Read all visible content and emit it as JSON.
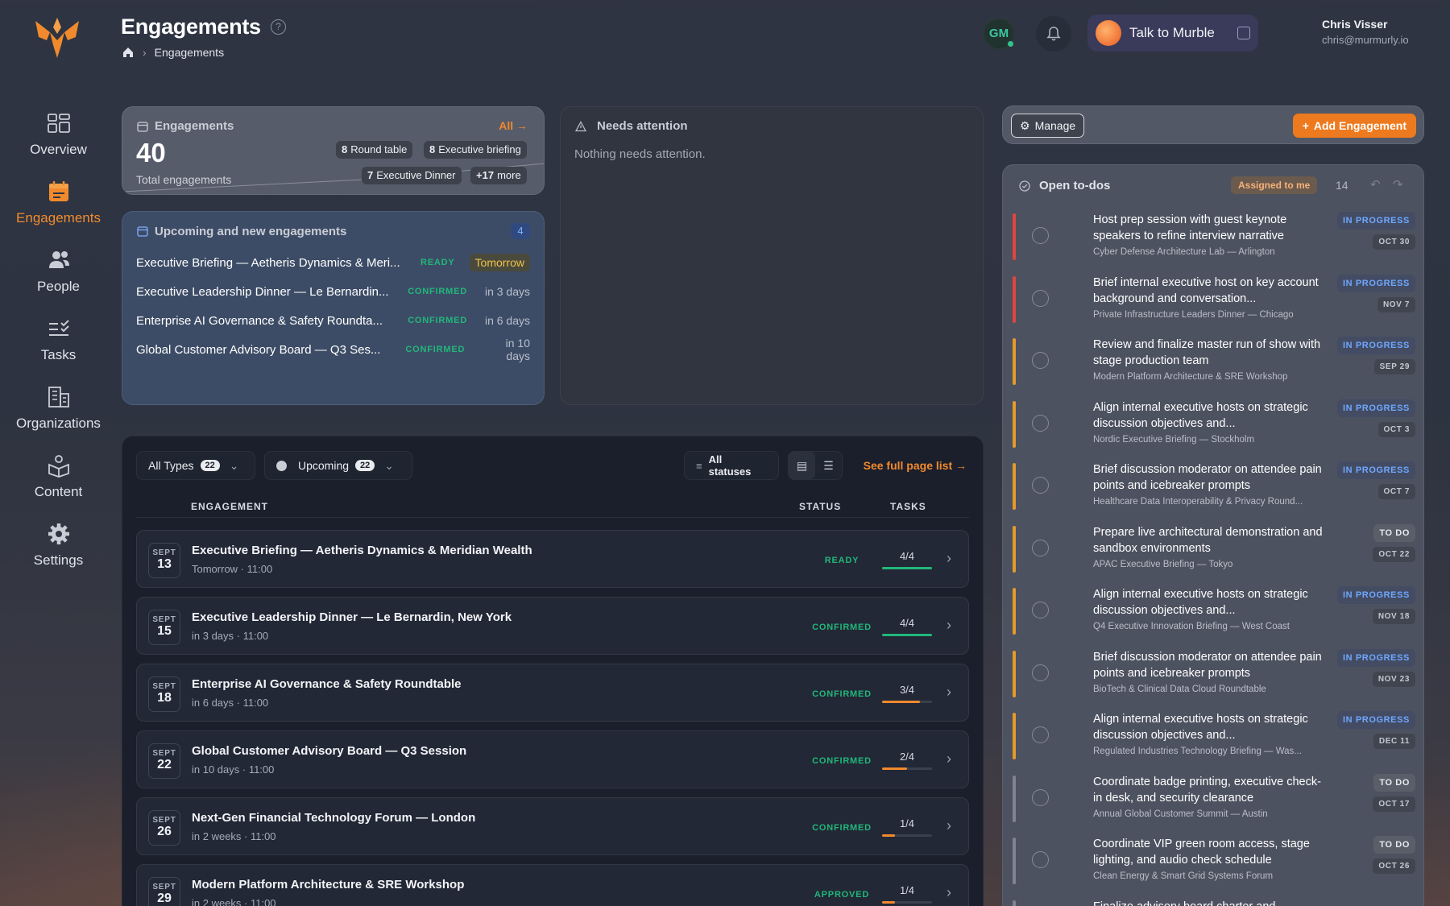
{
  "header": {
    "title": "Engagements",
    "breadcrumb_current": "Engagements",
    "avatar_initials": "GM",
    "murble_label": "Talk to Murble",
    "user_name": "Chris Visser",
    "user_email": "chris@murmurly.io"
  },
  "sidebar": {
    "items": [
      {
        "label": "Overview",
        "icon": "overview-grid-icon"
      },
      {
        "label": "Engagements",
        "icon": "calendar-icon",
        "active": true
      },
      {
        "label": "People",
        "icon": "people-icon"
      },
      {
        "label": "Tasks",
        "icon": "tasks-checklist-icon"
      },
      {
        "label": "Organizations",
        "icon": "building-icon"
      },
      {
        "label": "Content",
        "icon": "content-box-icon"
      },
      {
        "label": "Settings",
        "icon": "gear-icon"
      }
    ]
  },
  "stats": {
    "title": "Engagements",
    "all_label": "All",
    "total": "40",
    "total_label": "Total engagements",
    "chips": [
      {
        "count": "8",
        "label": "Round table"
      },
      {
        "count": "8",
        "label": "Executive briefing"
      },
      {
        "count": "7",
        "label": "Executive Dinner"
      },
      {
        "count": "+17",
        "label": "more"
      }
    ]
  },
  "upcoming": {
    "title": "Upcoming and new engagements",
    "count": "4",
    "items": [
      {
        "title": "Executive Briefing — Aetheris Dynamics & Meri...",
        "status": "READY",
        "when": "Tomorrow"
      },
      {
        "title": "Executive Leadership Dinner — Le Bernardin...",
        "status": "CONFIRMED",
        "when": "in 3 days"
      },
      {
        "title": "Enterprise AI Governance & Safety Roundta...",
        "status": "CONFIRMED",
        "when": "in 6 days"
      },
      {
        "title": "Global Customer Advisory Board — Q3 Ses...",
        "status": "CONFIRMED",
        "when": "in 10 days"
      }
    ]
  },
  "attention": {
    "title": "Needs attention",
    "empty": "Nothing needs attention."
  },
  "list": {
    "filter_types": "All Types",
    "filter_types_count": "22",
    "filter_time": "Upcoming",
    "filter_time_count": "22",
    "filter_status": "All statuses",
    "see_full": "See full page list",
    "headers": {
      "engagement": "ENGAGEMENT",
      "status": "STATUS",
      "tasks": "TASKS"
    },
    "rows": [
      {
        "month": "SEPT",
        "day": "13",
        "title": "Executive Briefing — Aetheris Dynamics & Meridian Wealth",
        "when": "Tomorrow",
        "time": "11:00",
        "status": "READY",
        "tasks": "4/4",
        "progress": 1.0,
        "bar_color": "#21b77a"
      },
      {
        "month": "SEPT",
        "day": "15",
        "title": "Executive Leadership Dinner — Le Bernardin, New York",
        "when": "in 3 days",
        "time": "11:00",
        "status": "CONFIRMED",
        "tasks": "4/4",
        "progress": 1.0,
        "bar_color": "#21b77a"
      },
      {
        "month": "SEPT",
        "day": "18",
        "title": "Enterprise AI Governance & Safety Roundtable",
        "when": "in 6 days",
        "time": "11:00",
        "status": "CONFIRMED",
        "tasks": "3/4",
        "progress": 0.75,
        "bar_color": "#f2892d"
      },
      {
        "month": "SEPT",
        "day": "22",
        "title": "Global Customer Advisory Board — Q3 Session",
        "when": "in 10 days",
        "time": "11:00",
        "status": "CONFIRMED",
        "tasks": "2/4",
        "progress": 0.5,
        "bar_color": "#f2892d"
      },
      {
        "month": "SEPT",
        "day": "26",
        "title": "Next-Gen Financial Technology Forum — London",
        "when": "in 2 weeks",
        "time": "11:00",
        "status": "CONFIRMED",
        "tasks": "1/4",
        "progress": 0.25,
        "bar_color": "#f2892d"
      },
      {
        "month": "SEPT",
        "day": "29",
        "title": "Modern Platform Architecture & SRE Workshop",
        "when": "in 2 weeks",
        "time": "11:00",
        "status": "APPROVED",
        "tasks": "1/4",
        "progress": 0.25,
        "bar_color": "#f2892d"
      }
    ]
  },
  "actions": {
    "manage": "Manage",
    "add": "Add Engagement"
  },
  "todos": {
    "title": "Open to-dos",
    "assigned": "Assigned to me",
    "count": "14",
    "items": [
      {
        "title": "Host prep session with guest keynote speakers to refine interview narrative",
        "sub": "Cyber Defense Architecture Lab — Arlington",
        "status": "IN PROGRESS",
        "kind": "prog",
        "date": "OCT 30",
        "stripe": "#e0453e"
      },
      {
        "title": "Brief internal executive host on key account background and conversation...",
        "sub": "Private Infrastructure Leaders Dinner — Chicago",
        "status": "IN PROGRESS",
        "kind": "prog",
        "date": "NOV 7",
        "stripe": "#e0453e"
      },
      {
        "title": "Review and finalize master run of show with stage production team",
        "sub": "Modern Platform Architecture & SRE Workshop",
        "status": "IN PROGRESS",
        "kind": "prog",
        "date": "SEP 29",
        "stripe": "#e59a2c"
      },
      {
        "title": "Align internal executive hosts on strategic discussion objectives and...",
        "sub": "Nordic Executive Briefing — Stockholm",
        "status": "IN PROGRESS",
        "kind": "prog",
        "date": "OCT 3",
        "stripe": "#e59a2c"
      },
      {
        "title": "Brief discussion moderator on attendee pain points and icebreaker prompts",
        "sub": "Healthcare Data Interoperability & Privacy Round...",
        "status": "IN PROGRESS",
        "kind": "prog",
        "date": "OCT 7",
        "stripe": "#e59a2c"
      },
      {
        "title": "Prepare live architectural demonstration and sandbox environments",
        "sub": "APAC Executive Briefing — Tokyo",
        "status": "TO DO",
        "kind": "todo",
        "date": "OCT 22",
        "stripe": "#e59a2c"
      },
      {
        "title": "Align internal executive hosts on strategic discussion objectives and...",
        "sub": "Q4 Executive Innovation Briefing — West Coast",
        "status": "IN PROGRESS",
        "kind": "prog",
        "date": "NOV 18",
        "stripe": "#e59a2c"
      },
      {
        "title": "Brief discussion moderator on attendee pain points and icebreaker prompts",
        "sub": "BioTech & Clinical Data Cloud Roundtable",
        "status": "IN PROGRESS",
        "kind": "prog",
        "date": "NOV 23",
        "stripe": "#e59a2c"
      },
      {
        "title": "Align internal executive hosts on strategic discussion objectives and...",
        "sub": "Regulated Industries Technology Briefing — Was...",
        "status": "IN PROGRESS",
        "kind": "prog",
        "date": "DEC 11",
        "stripe": "#e59a2c"
      },
      {
        "title": "Coordinate badge printing, executive check-in desk, and security clearance",
        "sub": "Annual Global Customer Summit — Austin",
        "status": "TO DO",
        "kind": "todo",
        "date": "OCT 17",
        "stripe": "#80848e"
      },
      {
        "title": "Coordinate VIP green room access, stage lighting, and audio check schedule",
        "sub": "Clean Energy & Smart Grid Systems Forum",
        "status": "TO DO",
        "kind": "todo",
        "date": "OCT 26",
        "stripe": "#80848e"
      },
      {
        "title": "Finalize advisory board charter and working...",
        "sub": "",
        "status": "",
        "kind": "todo",
        "date": "",
        "stripe": "#80848e"
      }
    ]
  }
}
